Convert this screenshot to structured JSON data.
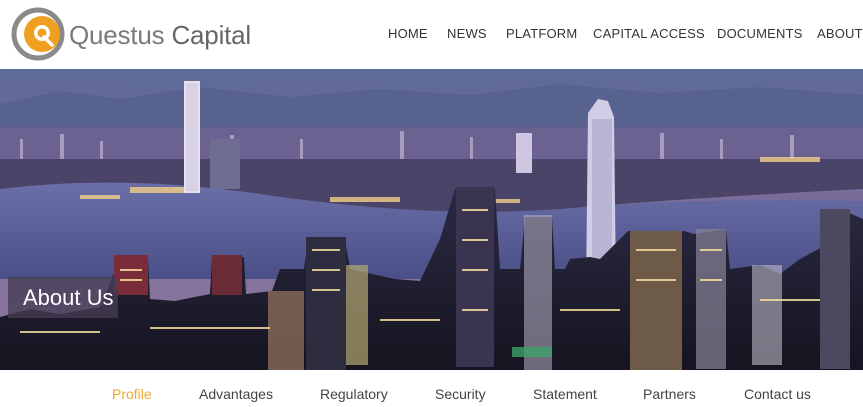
{
  "brand": {
    "name_part1": "Questus",
    "name_part2": "Capital",
    "logo_letter": "Q",
    "colors": {
      "orange": "#f0a020",
      "gray": "#8a8a8a"
    }
  },
  "nav": {
    "items": [
      {
        "label": "HOME"
      },
      {
        "label": "NEWS"
      },
      {
        "label": "PLATFORM"
      },
      {
        "label": "CAPITAL ACCESS"
      },
      {
        "label": "DOCUMENTS"
      },
      {
        "label": "ABOUT US"
      }
    ]
  },
  "hero": {
    "title": "About Us"
  },
  "subnav": {
    "active": "Profile",
    "items": [
      {
        "label": "Profile"
      },
      {
        "label": "Advantages"
      },
      {
        "label": "Regulatory"
      },
      {
        "label": "Security"
      },
      {
        "label": "Statement"
      },
      {
        "label": "Partners"
      },
      {
        "label": "Contact us"
      }
    ]
  },
  "colors": {
    "accent": "#f2a92a",
    "text": "#333333"
  }
}
